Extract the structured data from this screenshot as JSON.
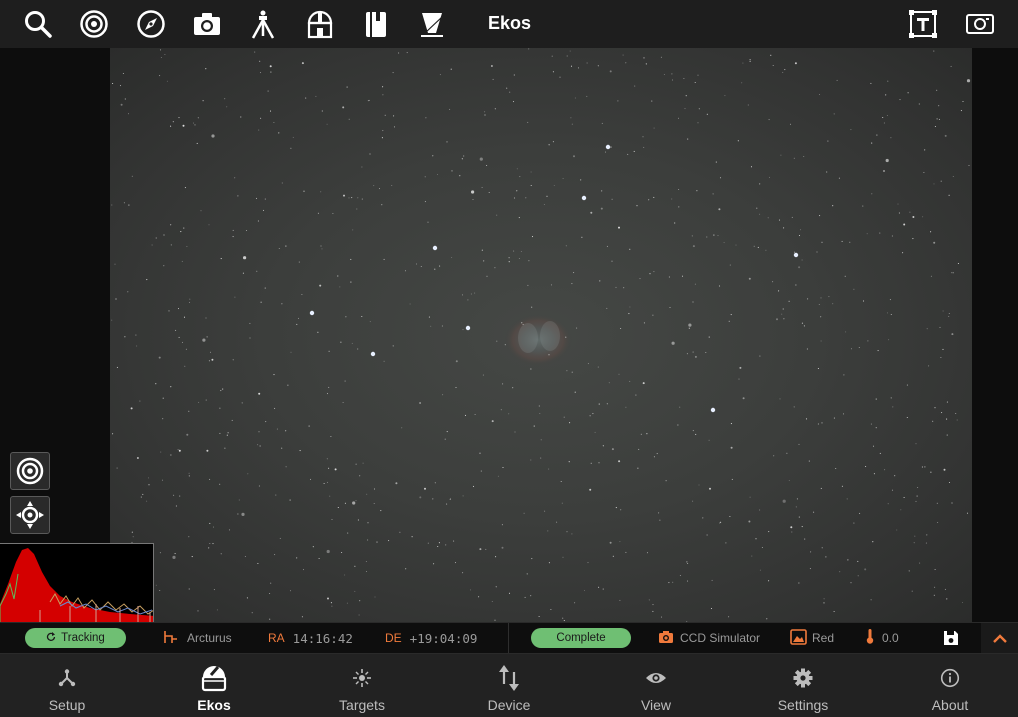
{
  "app": {
    "title": "Ekos"
  },
  "toolbar": {
    "left_icons": [
      "search-icon",
      "target-icon",
      "compass-icon",
      "camera-icon",
      "telescope-mount-icon",
      "observatory-icon",
      "notebook-icon",
      "flat-panel-icon"
    ],
    "right_icons": [
      "text-box-icon",
      "frame-icon"
    ]
  },
  "status": {
    "tracking_label": "Tracking",
    "target_name": "Arcturus",
    "ra_label": "RA",
    "ra_value": "14:16:42",
    "de_label": "DE",
    "de_value": "+19:04:09",
    "capture_state": "Complete",
    "camera_name": "CCD Simulator",
    "filter_name": "Red",
    "temperature": "0.0"
  },
  "nav": {
    "active": "Ekos",
    "items": [
      {
        "label": "Setup",
        "icon": "setup-icon"
      },
      {
        "label": "Ekos",
        "icon": "ekos-observatory-icon"
      },
      {
        "label": "Targets",
        "icon": "targets-icon"
      },
      {
        "label": "Device",
        "icon": "device-arrows-icon"
      },
      {
        "label": "View",
        "icon": "eye-icon"
      },
      {
        "label": "Settings",
        "icon": "gear-icon"
      },
      {
        "label": "About",
        "icon": "info-icon"
      }
    ]
  },
  "colors": {
    "accent": "#f07a3c",
    "status_pill": "#6fbf73",
    "histogram": "#d40000"
  }
}
